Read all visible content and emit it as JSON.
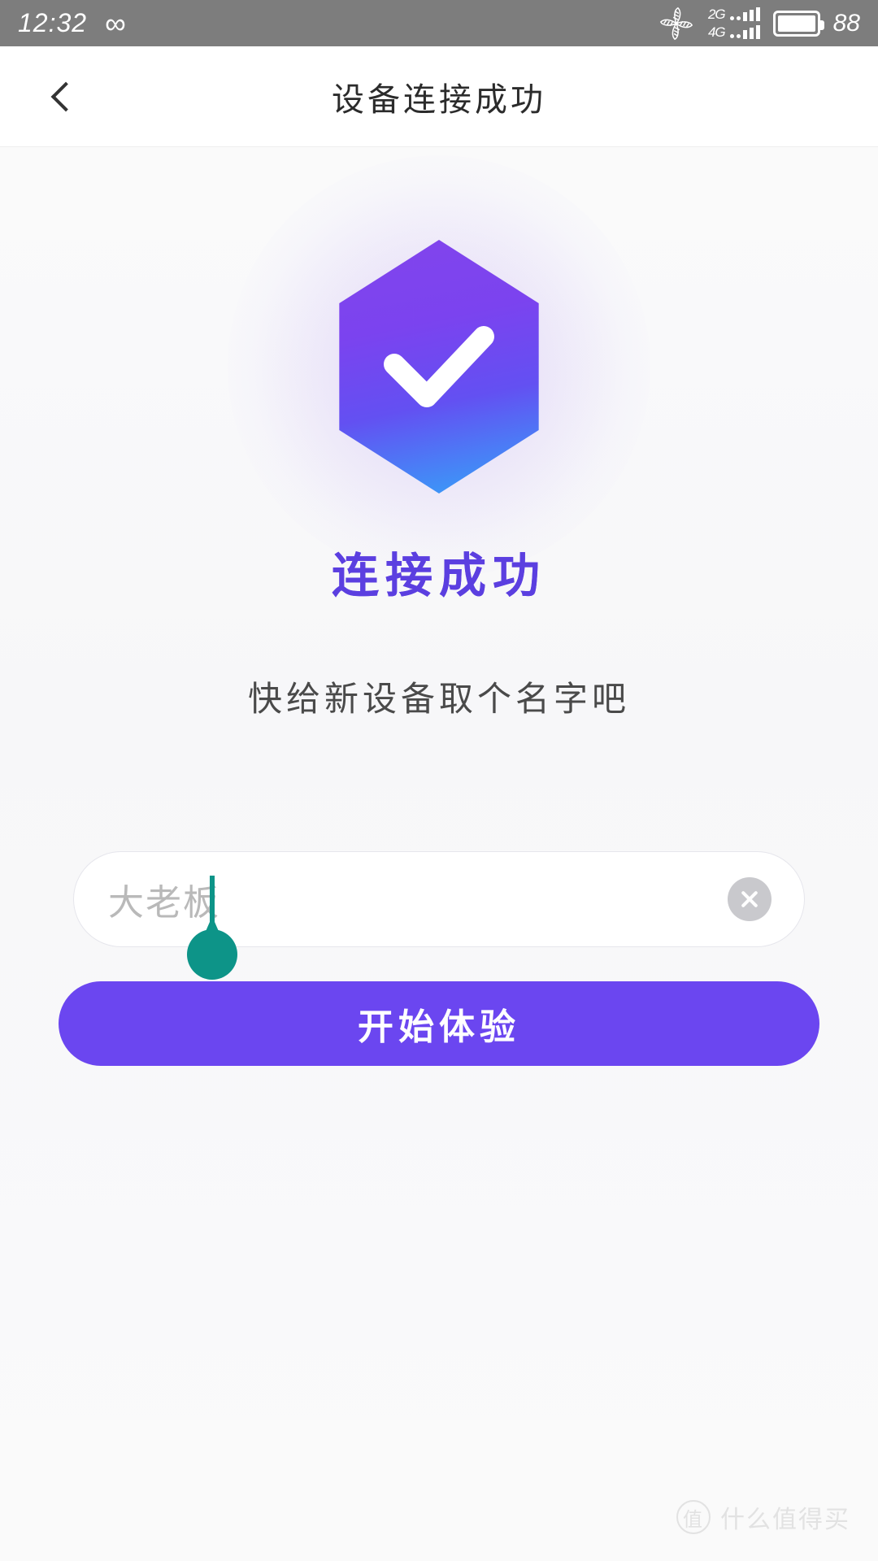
{
  "status_bar": {
    "time": "12:32",
    "infinity_icon": "infinity-icon",
    "fan_icon": "fan-icon",
    "net_2g_label": "2G",
    "net_4g_label": "4G",
    "battery_icon": "battery-icon",
    "battery_percent": "88"
  },
  "nav": {
    "back_icon": "chevron-left-icon",
    "title": "设备连接成功"
  },
  "main": {
    "badge_icon": "check-hexagon-icon",
    "success_text": "连接成功",
    "name_prompt": "快给新设备取个名字吧",
    "input": {
      "value": "",
      "placeholder": "大老板",
      "clear_icon": "clear-circle-icon"
    },
    "primary_button": "开始体验"
  },
  "watermark": {
    "logo": "值",
    "text": "什么值得买"
  },
  "colors": {
    "accent_purple": "#6b46f0",
    "success_text": "#5b3fe0",
    "badge_top": "#8245ec",
    "badge_bottom": "#33a6f8",
    "caret_teal": "#0d9488",
    "status_bar_bg": "#7d7d7d"
  }
}
